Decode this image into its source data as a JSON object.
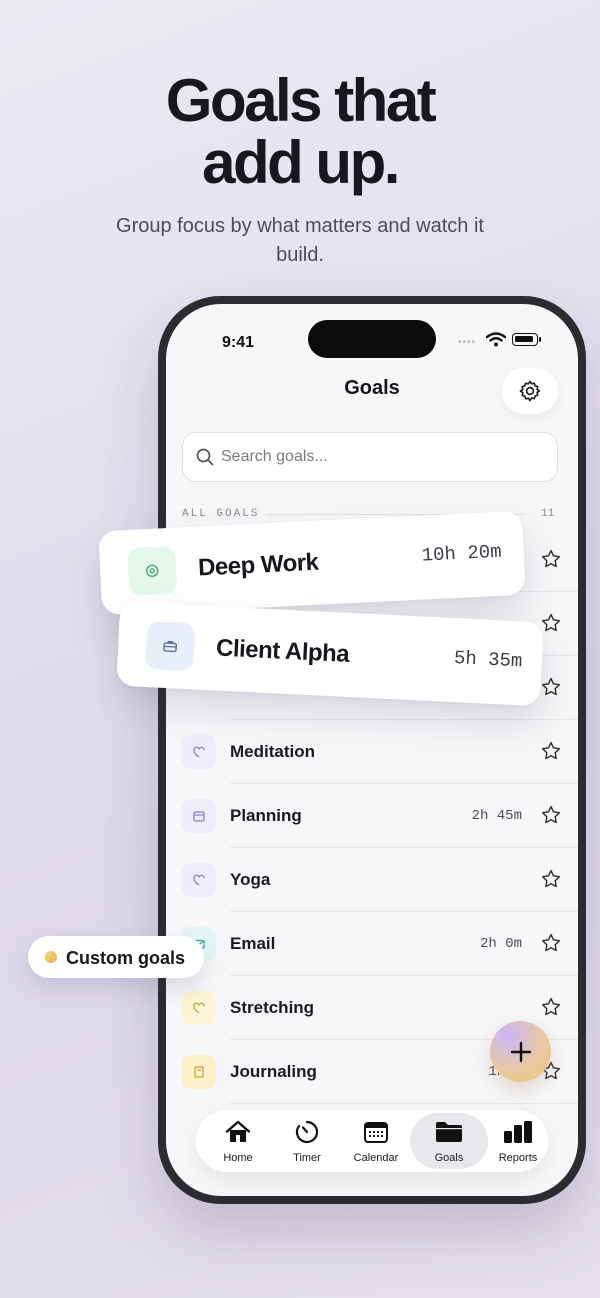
{
  "headline": {
    "line1": "Goals that",
    "line2": "add up."
  },
  "subhead": "Group focus by what matters and watch it build.",
  "status_bar": {
    "time": "9:41"
  },
  "screen": {
    "title": "Goals",
    "search_placeholder": "Search goals...",
    "section_label": "ALL GOALS",
    "section_count": "11"
  },
  "floating_cards": [
    {
      "name": "Deep Work",
      "time": "10h 20m",
      "icon": "target-icon",
      "icon_bg": "#e5f8ee",
      "icon_color": "#4ea574"
    },
    {
      "name": "Client Alpha",
      "time": "5h 35m",
      "icon": "briefcase-icon",
      "icon_bg": "#e8eefa",
      "icon_color": "#5a6f9a"
    }
  ],
  "goals": [
    {
      "name": "Meditation",
      "time": "",
      "icon": "heart-icon",
      "icon_bg": "#efedfa",
      "icon_color": "#8c80c8"
    },
    {
      "name": "Planning",
      "time": "2h 45m",
      "icon": "calendar-icon",
      "icon_bg": "#efedfa",
      "icon_color": "#8c80c8"
    },
    {
      "name": "Yoga",
      "time": "",
      "icon": "heart-icon",
      "icon_bg": "#efedfa",
      "icon_color": "#8c80c8"
    },
    {
      "name": "Email",
      "time": "2h 0m",
      "icon": "mail-icon",
      "icon_bg": "#e3f6f4",
      "icon_color": "#4aa59c"
    },
    {
      "name": "Stretching",
      "time": "",
      "icon": "heart-icon",
      "icon_bg": "#fbf5d8",
      "icon_color": "#c7a43a"
    },
    {
      "name": "Journaling",
      "time": "1h 3",
      "icon": "book-icon",
      "icon_bg": "#fbf1c9",
      "icon_color": "#c7a43a"
    }
  ],
  "pill": {
    "label": "Custom goals"
  },
  "tabs": [
    {
      "label": "Home",
      "icon": "home-icon"
    },
    {
      "label": "Timer",
      "icon": "timer-icon"
    },
    {
      "label": "Calendar",
      "icon": "calendar-icon"
    },
    {
      "label": "Goals",
      "icon": "folder-icon",
      "active": true
    },
    {
      "label": "Reports",
      "icon": "bar-chart-icon"
    }
  ]
}
